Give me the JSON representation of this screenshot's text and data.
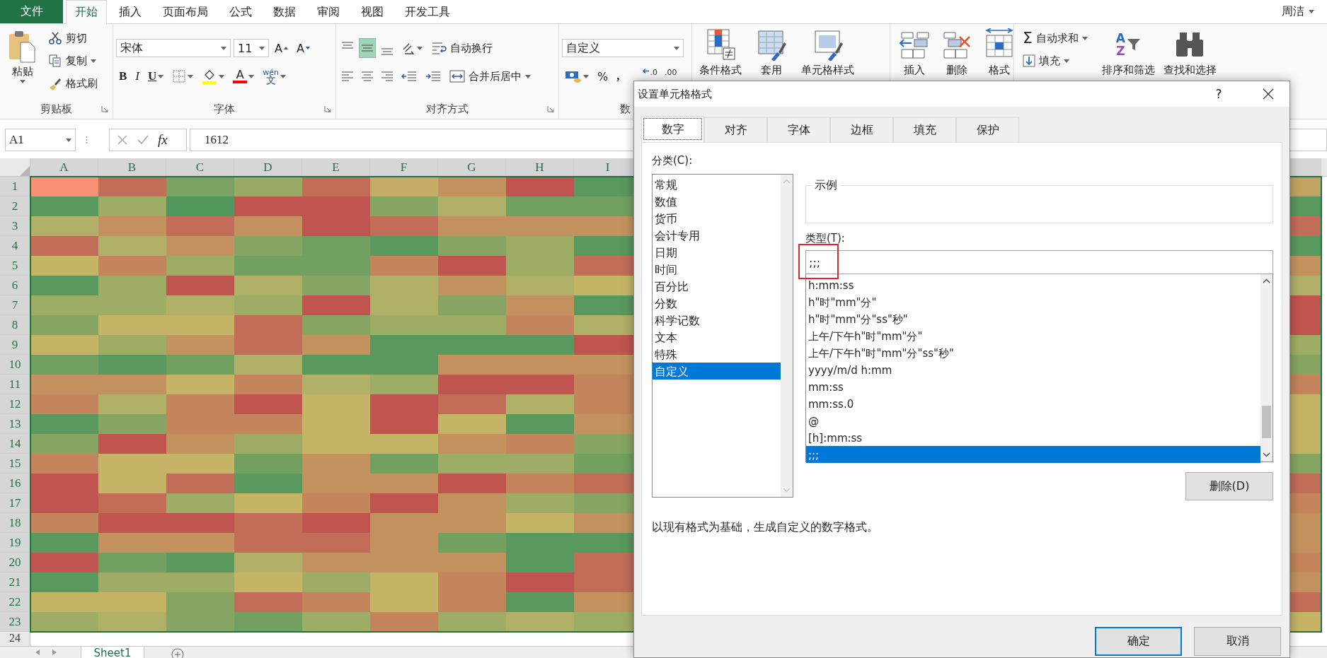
{
  "file_tab": {
    "label": "文件"
  },
  "tabs": [
    {
      "label": "开始",
      "selected": true
    },
    {
      "label": "插入",
      "selected": false
    },
    {
      "label": "页面布局",
      "selected": false
    },
    {
      "label": "公式",
      "selected": false
    },
    {
      "label": "数据",
      "selected": false
    },
    {
      "label": "审阅",
      "selected": false
    },
    {
      "label": "视图",
      "selected": false
    },
    {
      "label": "开发工具",
      "selected": false
    }
  ],
  "user": {
    "name": "周洁"
  },
  "clipboard": {
    "paste": "粘贴",
    "cut": "剪切",
    "copy": "复制",
    "format_painter": "格式刷",
    "label": "剪贴板"
  },
  "font": {
    "name": "宋体",
    "size": "11",
    "grow": "A",
    "shrink": "A",
    "bold": "B",
    "italic": "I",
    "underline": "U",
    "color_letter": "A",
    "phonetic_top": "wén",
    "phonetic_bottom": "文",
    "label": "字体"
  },
  "alignment": {
    "vertical": [
      {
        "kind": "top",
        "selected": false
      },
      {
        "kind": "middle",
        "selected": true
      },
      {
        "kind": "bottom",
        "selected": false
      }
    ],
    "wrap_text": "自动换行",
    "merge_center": "合并后居中",
    "label": "对齐方式"
  },
  "number": {
    "format": "自定义",
    "percent": "%",
    "comma": ",",
    "increase_decimal": ".0",
    "decrease_decimal": ".00",
    "label": "数"
  },
  "styles": [
    "条件格式",
    "套用",
    "单元格样式"
  ],
  "cells": [
    "插入",
    "删除",
    "格式"
  ],
  "editing": {
    "autosum_symbol": "Σ",
    "autosum": "自动求和",
    "fill": "填充",
    "sort_letters": [
      "A",
      "Z"
    ],
    "sort": "排序和筛选",
    "find": "查找和选择"
  },
  "formula_bar": {
    "name_box": "A1",
    "fx": "fx",
    "formula": "1612"
  },
  "sheet": {
    "columns": [
      "A",
      "B",
      "C",
      "D",
      "E",
      "F",
      "G",
      "H",
      "I"
    ],
    "rows": [
      {
        "number": "1",
        "cells": [
          {
            "color": "#f99274"
          },
          {
            "color": "#c26d58"
          },
          {
            "color": "#7aa262"
          },
          {
            "color": "#98aa64"
          },
          {
            "color": "#c26d58"
          },
          {
            "color": "#c4ac66"
          },
          {
            "color": "#c4925f"
          },
          {
            "color": "#c0544f"
          },
          {
            "color": "#5a995d"
          },
          {
            "color": "#c4a462"
          }
        ]
      },
      {
        "number": "2",
        "cells": [
          {
            "color": "#5a995d"
          },
          {
            "color": "#9ead65"
          },
          {
            "color": "#52975c"
          },
          {
            "color": "#c0544f"
          },
          {
            "color": "#c0544f"
          },
          {
            "color": "#87a562"
          },
          {
            "color": "#b1b068"
          },
          {
            "color": "#72a060"
          },
          {
            "color": "#72a060"
          },
          {
            "color": "#5a995d"
          }
        ]
      },
      {
        "number": "3",
        "cells": [
          {
            "color": "#b1b068"
          },
          {
            "color": "#c4925f"
          },
          {
            "color": "#c26d58"
          },
          {
            "color": "#c4925f"
          },
          {
            "color": "#c0544f"
          },
          {
            "color": "#c26d58"
          },
          {
            "color": "#c4925f"
          },
          {
            "color": "#c4925f"
          },
          {
            "color": "#c4925f"
          },
          {
            "color": "#c26d58"
          }
        ]
      },
      {
        "number": "4",
        "cells": [
          {
            "color": "#c26d58"
          },
          {
            "color": "#b1b068"
          },
          {
            "color": "#c4925f"
          },
          {
            "color": "#87a562"
          },
          {
            "color": "#72a060"
          },
          {
            "color": "#5a995d"
          },
          {
            "color": "#87a562"
          },
          {
            "color": "#9ead65"
          },
          {
            "color": "#5a995d"
          },
          {
            "color": "#5a995d"
          }
        ]
      },
      {
        "number": "5",
        "cells": [
          {
            "color": "#c6b466"
          },
          {
            "color": "#c4855c"
          },
          {
            "color": "#9ead65"
          },
          {
            "color": "#72a060"
          },
          {
            "color": "#72a060"
          },
          {
            "color": "#c4855c"
          },
          {
            "color": "#c0544f"
          },
          {
            "color": "#9ead65"
          },
          {
            "color": "#c26d58"
          },
          {
            "color": "#c4925f"
          }
        ]
      },
      {
        "number": "6",
        "cells": [
          {
            "color": "#5a995d"
          },
          {
            "color": "#9ead65"
          },
          {
            "color": "#c0544f"
          },
          {
            "color": "#b1b068"
          },
          {
            "color": "#87a562"
          },
          {
            "color": "#b1b068"
          },
          {
            "color": "#c4925f"
          },
          {
            "color": "#b1b068"
          },
          {
            "color": "#c6b466"
          },
          {
            "color": "#b1b068"
          }
        ]
      },
      {
        "number": "7",
        "cells": [
          {
            "color": "#9ead65"
          },
          {
            "color": "#9ead65"
          },
          {
            "color": "#b1b068"
          },
          {
            "color": "#9ead65"
          },
          {
            "color": "#c0544f"
          },
          {
            "color": "#b1b068"
          },
          {
            "color": "#87a562"
          },
          {
            "color": "#c4925f"
          },
          {
            "color": "#5a995d"
          },
          {
            "color": "#c0544f"
          }
        ]
      },
      {
        "number": "8",
        "cells": [
          {
            "color": "#87a562"
          },
          {
            "color": "#c6b466"
          },
          {
            "color": "#c6b466"
          },
          {
            "color": "#c26d58"
          },
          {
            "color": "#87a562"
          },
          {
            "color": "#9ead65"
          },
          {
            "color": "#9ead65"
          },
          {
            "color": "#c4855c"
          },
          {
            "color": "#b1b068"
          },
          {
            "color": "#c0544f"
          }
        ]
      },
      {
        "number": "9",
        "cells": [
          {
            "color": "#c6b466"
          },
          {
            "color": "#9ead65"
          },
          {
            "color": "#c4925f"
          },
          {
            "color": "#c26d58"
          },
          {
            "color": "#c4925f"
          },
          {
            "color": "#5a995d"
          },
          {
            "color": "#5a995d"
          },
          {
            "color": "#5a995d"
          },
          {
            "color": "#c0544f"
          },
          {
            "color": "#9ead65"
          }
        ]
      },
      {
        "number": "10",
        "cells": [
          {
            "color": "#72a060"
          },
          {
            "color": "#5a995d"
          },
          {
            "color": "#72a060"
          },
          {
            "color": "#b1b068"
          },
          {
            "color": "#5a995d"
          },
          {
            "color": "#5a995d"
          },
          {
            "color": "#c4925f"
          },
          {
            "color": "#c4925f"
          },
          {
            "color": "#c4925f"
          },
          {
            "color": "#87a562"
          }
        ]
      },
      {
        "number": "11",
        "cells": [
          {
            "color": "#c4925f"
          },
          {
            "color": "#c4925f"
          },
          {
            "color": "#c6b466"
          },
          {
            "color": "#c4855c"
          },
          {
            "color": "#b1b068"
          },
          {
            "color": "#9ead65"
          },
          {
            "color": "#c0544f"
          },
          {
            "color": "#c0544f"
          },
          {
            "color": "#c4855c"
          },
          {
            "color": "#c4855c"
          }
        ]
      },
      {
        "number": "12",
        "cells": [
          {
            "color": "#c4855c"
          },
          {
            "color": "#b1b068"
          },
          {
            "color": "#c4855c"
          },
          {
            "color": "#c0544f"
          },
          {
            "color": "#c6b466"
          },
          {
            "color": "#c0544f"
          },
          {
            "color": "#c26d58"
          },
          {
            "color": "#b1b068"
          },
          {
            "color": "#c4855c"
          },
          {
            "color": "#c6b466"
          }
        ]
      },
      {
        "number": "13",
        "cells": [
          {
            "color": "#5a995d"
          },
          {
            "color": "#87a562"
          },
          {
            "color": "#c4855c"
          },
          {
            "color": "#c4855c"
          },
          {
            "color": "#c6b466"
          },
          {
            "color": "#c0544f"
          },
          {
            "color": "#c6b466"
          },
          {
            "color": "#5a995d"
          },
          {
            "color": "#c4925f"
          },
          {
            "color": "#c6b466"
          }
        ]
      },
      {
        "number": "14",
        "cells": [
          {
            "color": "#87a562"
          },
          {
            "color": "#c0544f"
          },
          {
            "color": "#c4925f"
          },
          {
            "color": "#9ead65"
          },
          {
            "color": "#c6b466"
          },
          {
            "color": "#c6b466"
          },
          {
            "color": "#c4925f"
          },
          {
            "color": "#c4855c"
          },
          {
            "color": "#87a562"
          },
          {
            "color": "#c6b466"
          }
        ]
      },
      {
        "number": "15",
        "cells": [
          {
            "color": "#c4855c"
          },
          {
            "color": "#c6b466"
          },
          {
            "color": "#c6b466"
          },
          {
            "color": "#72a060"
          },
          {
            "color": "#c4925f"
          },
          {
            "color": "#72a060"
          },
          {
            "color": "#9ead65"
          },
          {
            "color": "#9ead65"
          },
          {
            "color": "#72a060"
          },
          {
            "color": "#87a562"
          }
        ]
      },
      {
        "number": "16",
        "cells": [
          {
            "color": "#c0544f"
          },
          {
            "color": "#c6b466"
          },
          {
            "color": "#c26d58"
          },
          {
            "color": "#5a995d"
          },
          {
            "color": "#c4925f"
          },
          {
            "color": "#c4925f"
          },
          {
            "color": "#c0544f"
          },
          {
            "color": "#c4855c"
          },
          {
            "color": "#c26d58"
          },
          {
            "color": "#c26d58"
          }
        ]
      },
      {
        "number": "17",
        "cells": [
          {
            "color": "#c0544f"
          },
          {
            "color": "#c26d58"
          },
          {
            "color": "#9ead65"
          },
          {
            "color": "#c6b466"
          },
          {
            "color": "#c4855c"
          },
          {
            "color": "#c0544f"
          },
          {
            "color": "#c4925f"
          },
          {
            "color": "#9ead65"
          },
          {
            "color": "#87a562"
          },
          {
            "color": "#c4855c"
          }
        ]
      },
      {
        "number": "18",
        "cells": [
          {
            "color": "#c4855c"
          },
          {
            "color": "#c0544f"
          },
          {
            "color": "#c0544f"
          },
          {
            "color": "#c26d58"
          },
          {
            "color": "#c0544f"
          },
          {
            "color": "#c4925f"
          },
          {
            "color": "#c4925f"
          },
          {
            "color": "#c6b466"
          },
          {
            "color": "#c4925f"
          },
          {
            "color": "#c4925f"
          }
        ]
      },
      {
        "number": "19",
        "cells": [
          {
            "color": "#5a995d"
          },
          {
            "color": "#c4925f"
          },
          {
            "color": "#c4925f"
          },
          {
            "color": "#c26d58"
          },
          {
            "color": "#c26d58"
          },
          {
            "color": "#c4925f"
          },
          {
            "color": "#72a060"
          },
          {
            "color": "#5a995d"
          },
          {
            "color": "#5a995d"
          },
          {
            "color": "#c4925f"
          }
        ]
      },
      {
        "number": "20",
        "cells": [
          {
            "color": "#c0544f"
          },
          {
            "color": "#72a060"
          },
          {
            "color": "#5a995d"
          },
          {
            "color": "#b1b068"
          },
          {
            "color": "#c4925f"
          },
          {
            "color": "#c4925f"
          },
          {
            "color": "#c4925f"
          },
          {
            "color": "#5a995d"
          },
          {
            "color": "#c26d58"
          },
          {
            "color": "#c4855c"
          }
        ]
      },
      {
        "number": "21",
        "cells": [
          {
            "color": "#5a995d"
          },
          {
            "color": "#9ead65"
          },
          {
            "color": "#9ead65"
          },
          {
            "color": "#c6b466"
          },
          {
            "color": "#9ead65"
          },
          {
            "color": "#c6b466"
          },
          {
            "color": "#c4855c"
          },
          {
            "color": "#c0544f"
          },
          {
            "color": "#c26d58"
          },
          {
            "color": "#c4925f"
          }
        ]
      },
      {
        "number": "22",
        "cells": [
          {
            "color": "#c6b466"
          },
          {
            "color": "#c6b466"
          },
          {
            "color": "#87a562"
          },
          {
            "color": "#c26d58"
          },
          {
            "color": "#c4855c"
          },
          {
            "color": "#c6b466"
          },
          {
            "color": "#c4855c"
          },
          {
            "color": "#5a995d"
          },
          {
            "color": "#c4925f"
          },
          {
            "color": "#c26d58"
          }
        ]
      },
      {
        "number": "23",
        "cells": [
          {
            "color": "#9ead65"
          },
          {
            "color": "#b1b068"
          },
          {
            "color": "#87a562"
          },
          {
            "color": "#72a060"
          },
          {
            "color": "#9ead65"
          },
          {
            "color": "#c4855c"
          },
          {
            "color": "#9ead65"
          },
          {
            "color": "#b1b068"
          },
          {
            "color": "#9ead65"
          },
          {
            "color": "#c6b466"
          }
        ]
      }
    ],
    "partial_row": "24",
    "tabs": [
      {
        "label": "Sheet1",
        "selected": true
      }
    ]
  },
  "dialog": {
    "title": "设置单元格格式",
    "help": "?",
    "tabs": [
      {
        "label": "数字",
        "selected": true
      },
      {
        "label": "对齐",
        "selected": false
      },
      {
        "label": "字体",
        "selected": false
      },
      {
        "label": "边框",
        "selected": false
      },
      {
        "label": "填充",
        "selected": false
      },
      {
        "label": "保护",
        "selected": false
      }
    ],
    "category_label": "分类(C):",
    "categories": [
      {
        "label": "常规",
        "selected": false
      },
      {
        "label": "数值",
        "selected": false
      },
      {
        "label": "货币",
        "selected": false
      },
      {
        "label": "会计专用",
        "selected": false
      },
      {
        "label": "日期",
        "selected": false
      },
      {
        "label": "时间",
        "selected": false
      },
      {
        "label": "百分比",
        "selected": false
      },
      {
        "label": "分数",
        "selected": false
      },
      {
        "label": "科学记数",
        "selected": false
      },
      {
        "label": "文本",
        "selected": false
      },
      {
        "label": "特殊",
        "selected": false
      },
      {
        "label": "自定义",
        "selected": true
      }
    ],
    "sample_label": "示例",
    "type_label": "类型(T):",
    "type_value": ";;;",
    "formats": [
      {
        "label": "h:mm:ss",
        "selected": false
      },
      {
        "label": "h\"时\"mm\"分\"",
        "selected": false
      },
      {
        "label": "h\"时\"mm\"分\"ss\"秒\"",
        "selected": false
      },
      {
        "label": "上午/下午h\"时\"mm\"分\"",
        "selected": false
      },
      {
        "label": "上午/下午h\"时\"mm\"分\"ss\"秒\"",
        "selected": false
      },
      {
        "label": "yyyy/m/d h:mm",
        "selected": false
      },
      {
        "label": "mm:ss",
        "selected": false
      },
      {
        "label": "mm:ss.0",
        "selected": false
      },
      {
        "label": "@",
        "selected": false
      },
      {
        "label": "[h]:mm:ss",
        "selected": false
      },
      {
        "label": ";;;",
        "selected": true
      }
    ],
    "delete": "删除(D)",
    "description": "以现有格式为基础，生成自定义的数字格式。",
    "ok": "确定",
    "cancel": "取消"
  }
}
